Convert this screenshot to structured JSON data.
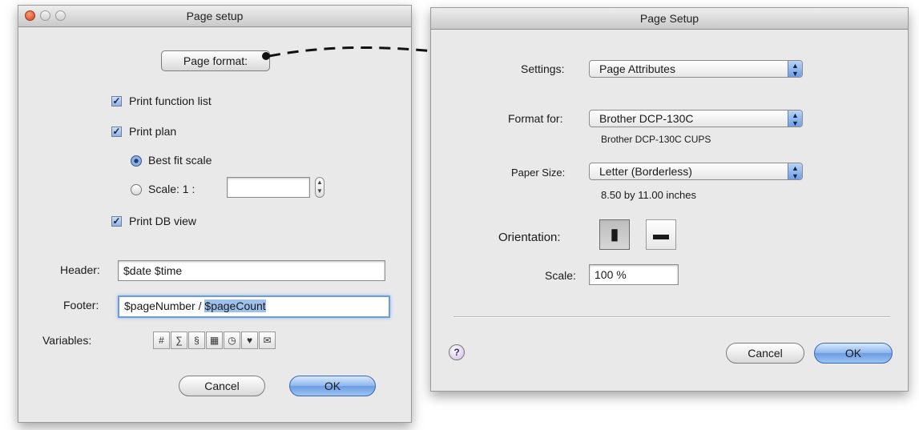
{
  "left_dialog": {
    "title": "Page setup",
    "page_format_button": "Page format:",
    "checkbox_function_list": "Print function list",
    "checkbox_plan": "Print plan",
    "radio_best_fit": "Best fit scale",
    "radio_scale": "Scale: 1 :",
    "scale_value": "",
    "checkbox_db_view": "Print DB view",
    "header_label": "Header:",
    "header_value": "$date $time",
    "footer_label": "Footer:",
    "footer_value_plain": "$pageNumber / ",
    "footer_value_selected": "$pageCount",
    "variables_label": "Variables:",
    "variable_icons": [
      "page-icon",
      "page-count-icon",
      "date-icon",
      "calendar-icon",
      "clock-icon",
      "user-icon",
      "file-icon"
    ],
    "cancel": "Cancel",
    "ok": "OK"
  },
  "right_dialog": {
    "title": "Page Setup",
    "settings_label": "Settings:",
    "settings_value": "Page Attributes",
    "format_for_label": "Format for:",
    "format_for_value": "Brother DCP-130C",
    "format_for_sub": "Brother DCP-130C CUPS",
    "paper_size_label": "Paper Size:",
    "paper_size_value": "Letter (Borderless)",
    "paper_size_sub": "8.50 by 11.00 inches",
    "orientation_label": "Orientation:",
    "scale_label": "Scale:",
    "scale_value": "100 %",
    "cancel": "Cancel",
    "ok": "OK"
  },
  "colors": {
    "window_bg": "#e9e9e9",
    "focus_ring": "#6d9be0",
    "default_button": "#8fb8ef",
    "selection": "#9fc0ec"
  }
}
